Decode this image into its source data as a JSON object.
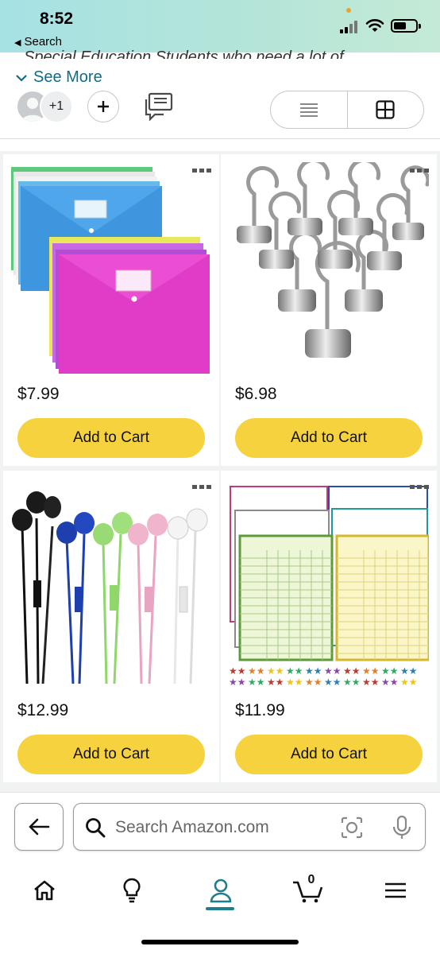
{
  "status_bar": {
    "time": "8:52",
    "back_label": "Search"
  },
  "header": {
    "partial_text": "Special Education Students who need a lot of",
    "see_more": "See More",
    "collaborators_extra": "+1"
  },
  "products": [
    {
      "price": "$7.99",
      "button": "Add to Cart",
      "image": "colorful plastic envelope folders"
    },
    {
      "price": "$6.98",
      "button": "Add to Cart",
      "image": "magnetic hooks"
    },
    {
      "price": "$12.99",
      "button": "Add to Cart",
      "image": "colorful wired earbuds"
    },
    {
      "price": "$11.99",
      "button": "Add to Cart",
      "image": "classroom record charts with star stickers"
    }
  ],
  "search": {
    "placeholder": "Search Amazon.com"
  },
  "nav": {
    "cart_count": "0",
    "active": "account"
  },
  "colors": {
    "button_yellow": "#f7d23f",
    "accent_teal": "#1f7f8f",
    "link_blue": "#0f6c8a",
    "badge_red": "#e0245e"
  }
}
